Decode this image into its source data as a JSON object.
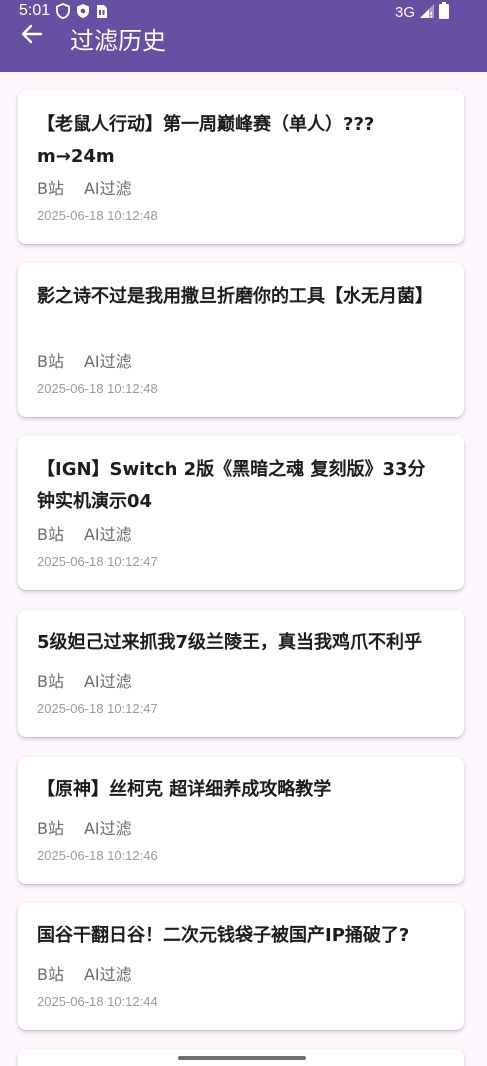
{
  "status_bar": {
    "time": "5:01",
    "network": "3G",
    "icons": [
      "shield-icon",
      "security-badge-icon",
      "sim-card-icon",
      "signal-icon",
      "battery-icon"
    ]
  },
  "app_bar": {
    "title": "过滤历史",
    "back_icon": "arrow-left-icon"
  },
  "colors": {
    "primary": "#6750a4",
    "background": "#fdf7fd",
    "card": "#ffffff",
    "title_text": "#1c1b1f",
    "tag_text": "#6b6b6b",
    "time_text": "#9a9a9a"
  },
  "items": [
    {
      "title": "【老鼠人行动】第一周巅峰赛（单人）???m→24m",
      "source": "B站",
      "filter": "AI过滤",
      "time": "2025-06-18 10:12:48"
    },
    {
      "title": "影之诗不过是我用撒旦折磨你的工具【水无月菌】",
      "source": "B站",
      "filter": "AI过滤",
      "time": "2025-06-18 10:12:48"
    },
    {
      "title": "【IGN】Switch 2版《黑暗之魂 复刻版》33分钟实机演示04",
      "source": "B站",
      "filter": "AI过滤",
      "time": "2025-06-18 10:12:47"
    },
    {
      "title": "5级妲己过来抓我7级兰陵王，真当我鸡爪不利乎",
      "source": "B站",
      "filter": "AI过滤",
      "time": "2025-06-18 10:12:47"
    },
    {
      "title": "【原神】丝柯克 超详细养成攻略教学",
      "source": "B站",
      "filter": "AI过滤",
      "time": "2025-06-18 10:12:46"
    },
    {
      "title": "国谷干翻日谷！二次元钱袋子被国产IP捅破了?",
      "source": "B站",
      "filter": "AI过滤",
      "time": "2025-06-18 10:12:44"
    }
  ]
}
